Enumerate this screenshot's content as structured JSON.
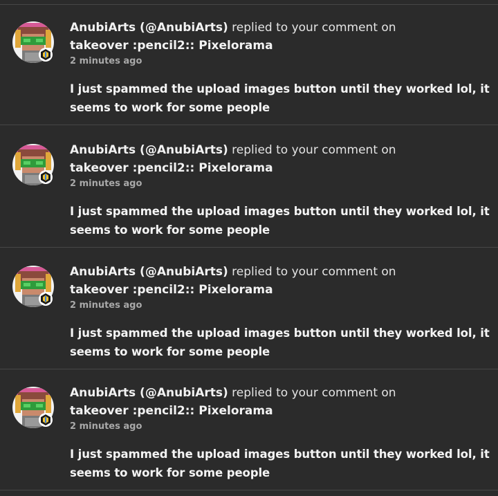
{
  "notifications": [
    {
      "user": "AnubiArts (@AnubiArts)",
      "action": "replied to your comment on",
      "target": "takeover :pencil2:: Pixelorama",
      "time": "2 minutes ago",
      "message": "I just spammed the upload images button until they worked lol, it seems to work for some people",
      "avatar_icon": "pixel-avatar-icon"
    },
    {
      "user": "AnubiArts (@AnubiArts)",
      "action": "replied to your comment on",
      "target": "takeover :pencil2:: Pixelorama",
      "time": "2 minutes ago",
      "message": "I just spammed the upload images button until they worked lol, it seems to work for some people",
      "avatar_icon": "pixel-avatar-icon"
    },
    {
      "user": "AnubiArts (@AnubiArts)",
      "action": "replied to your comment on",
      "target": "takeover :pencil2:: Pixelorama",
      "time": "2 minutes ago",
      "message": "I just spammed the upload images button until they worked lol, it seems to work for some people",
      "avatar_icon": "pixel-avatar-icon"
    },
    {
      "user": "AnubiArts (@AnubiArts)",
      "action": "replied to your comment on",
      "target": "takeover :pencil2:: Pixelorama",
      "time": "2 minutes ago",
      "message": "I just spammed the upload images button until they worked lol, it seems to work for some people",
      "avatar_icon": "pixel-avatar-icon"
    }
  ],
  "colors": {
    "background": "#2b2b2b",
    "divider": "#474747",
    "text_primary": "#f2f2f2",
    "text_muted": "#a9a9a9"
  }
}
